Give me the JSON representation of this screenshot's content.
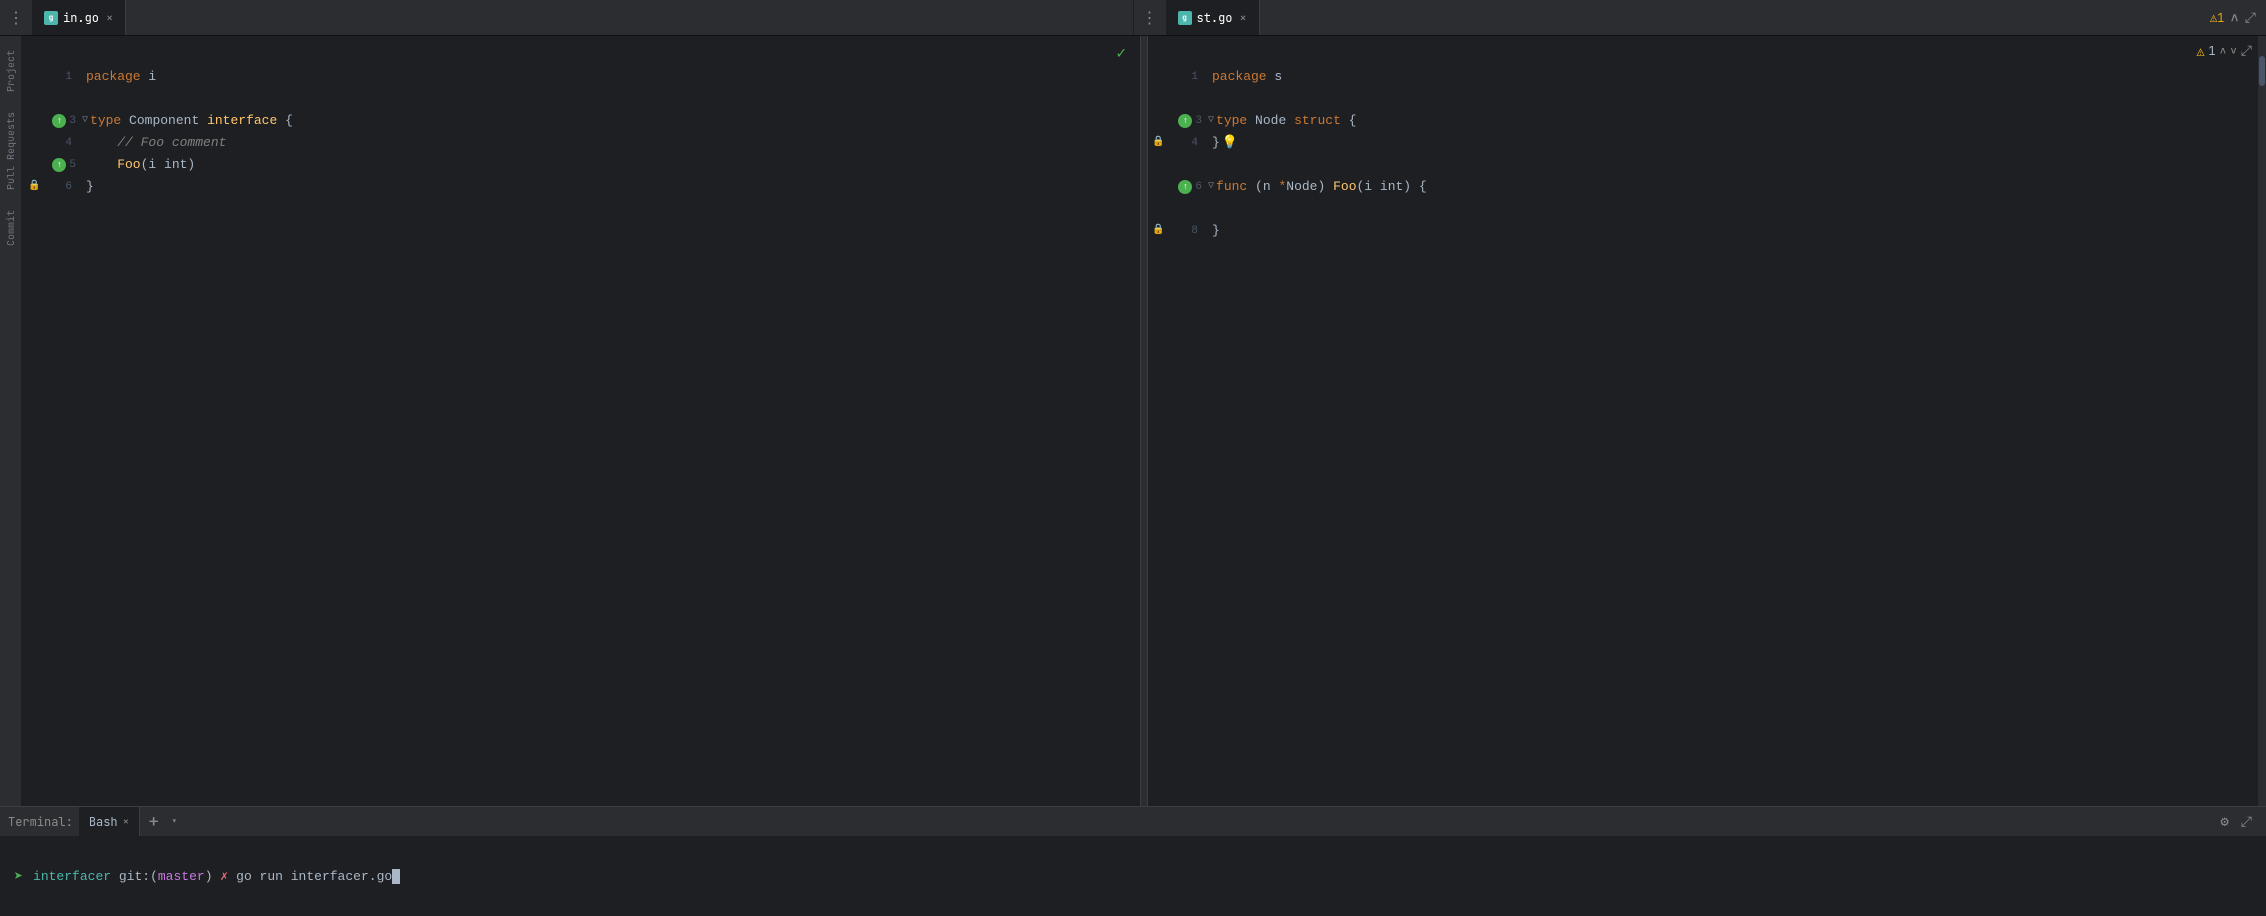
{
  "tabs": {
    "left": {
      "icon_color": "#4db6ac",
      "label": "in.go",
      "close": "×",
      "menu_dots": "⋮"
    },
    "right": {
      "icon_color": "#4db6ac",
      "label": "st.go",
      "close": "×",
      "menu_dots": "⋮",
      "warning_count": "⚠1"
    }
  },
  "sidebar": {
    "items": [
      {
        "label": "Project"
      },
      {
        "label": "Pull Requests"
      },
      {
        "label": "Commit"
      }
    ]
  },
  "left_editor": {
    "checkmark": "✓",
    "lines": [
      {
        "num": "",
        "gutter_icon": false,
        "fold": false,
        "content": ""
      },
      {
        "num": "1",
        "gutter_icon": false,
        "fold": false,
        "content": "package i"
      },
      {
        "num": "",
        "gutter_icon": false,
        "fold": false,
        "content": ""
      },
      {
        "num": "3",
        "gutter_icon": true,
        "fold": true,
        "content": "type Component interface {"
      },
      {
        "num": "4",
        "gutter_icon": false,
        "fold": false,
        "content": "    // Foo comment"
      },
      {
        "num": "5",
        "gutter_icon": true,
        "fold": false,
        "content": "    Foo(i int)"
      },
      {
        "num": "6",
        "gutter_icon": false,
        "fold": false,
        "content": "}"
      },
      {
        "num": "",
        "gutter_icon": false,
        "fold": false,
        "content": ""
      }
    ]
  },
  "right_editor": {
    "warning": "⚠1",
    "lines": [
      {
        "num": "",
        "gutter_icon": false,
        "fold": false,
        "content": ""
      },
      {
        "num": "1",
        "gutter_icon": false,
        "fold": false,
        "content": "package s"
      },
      {
        "num": "",
        "gutter_icon": false,
        "fold": false,
        "content": ""
      },
      {
        "num": "3",
        "gutter_icon": true,
        "fold": true,
        "content": "type Node struct {"
      },
      {
        "num": "4",
        "gutter_icon": false,
        "fold": false,
        "content": "}"
      },
      {
        "num": "",
        "gutter_icon": false,
        "fold": false,
        "content": ""
      },
      {
        "num": "6",
        "gutter_icon": true,
        "fold": true,
        "content": "func (n *Node) Foo(i int) {"
      },
      {
        "num": "",
        "gutter_icon": false,
        "fold": false,
        "content": ""
      },
      {
        "num": "8",
        "gutter_icon": false,
        "fold": false,
        "content": "}"
      }
    ]
  },
  "terminal": {
    "label": "Terminal:",
    "tab_label": "Bash",
    "close": "×",
    "add": "+",
    "dropdown": "▾",
    "settings_icon": "⚙",
    "maximize_icon": "⤢",
    "cwd": "interfacer",
    "git_label": "git:",
    "branch_open": "(",
    "branch": "master",
    "branch_close": ")",
    "git_x": "✗",
    "command": " go run interfacer.go"
  },
  "colors": {
    "keyword": "#cc7832",
    "interface_kw": "#ffc66d",
    "method": "#ffc66d",
    "comment": "#808080",
    "background": "#1e1f22",
    "tab_bg": "#2b2d30",
    "green": "#4caf50",
    "warning": "#e2a617"
  }
}
